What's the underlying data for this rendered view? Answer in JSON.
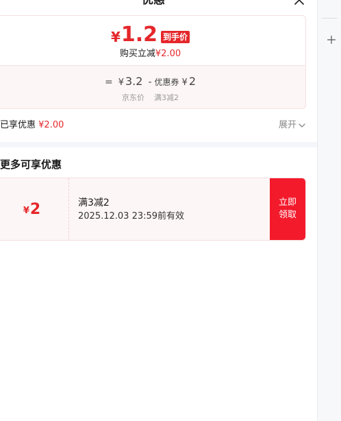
{
  "header": {
    "title": "优惠"
  },
  "price_card": {
    "currency_symbol": "¥",
    "final_price": "1.2",
    "final_badge": "到手价",
    "instant_prefix": "购买立减",
    "instant_amount": "¥2.00",
    "formula": {
      "equals": "=",
      "jd_price_symbol": "¥",
      "jd_price": "3.2",
      "minus": "-",
      "coupon_label": "优惠券",
      "coupon_symbol": "¥",
      "coupon_value": "2",
      "jd_price_label": "京东价",
      "coupon_rule_label": "满3减2"
    }
  },
  "enjoyed": {
    "label": "已享优惠",
    "amount": "¥2.00",
    "expand_label": "展开"
  },
  "more_section": {
    "title": "更多可享优惠"
  },
  "coupons": [
    {
      "currency_symbol": "¥",
      "amount": "2",
      "name": "满3减2",
      "expire": "2025.12.03 23:59前有效",
      "claim_line1": "立即",
      "claim_line2": "领取"
    }
  ],
  "icons": {
    "close": "close-icon",
    "expand": "chevron-down-icon",
    "add": "plus-icon"
  },
  "colors": {
    "accent_red": "#e5272b",
    "button_red": "#f31a2c",
    "muted_text": "#999999"
  }
}
